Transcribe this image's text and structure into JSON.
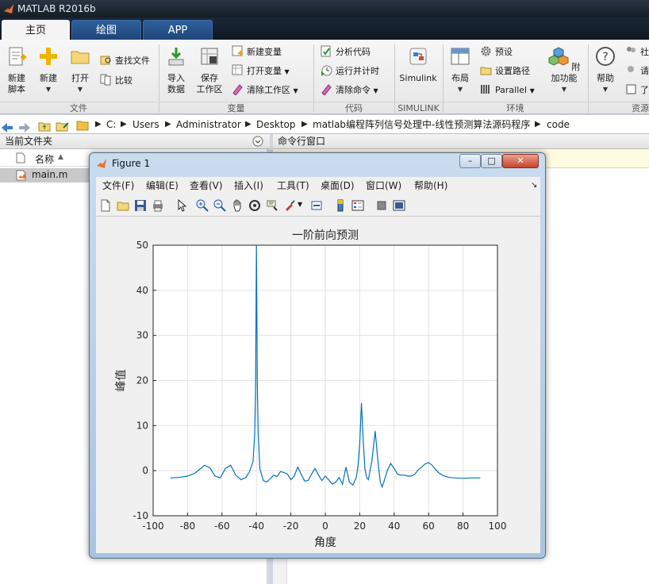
{
  "app": {
    "title": "MATLAB R2016b"
  },
  "tabs": [
    "主页",
    "绘图",
    "APP"
  ],
  "ribbon": {
    "new_script": "新建\n脚本",
    "new": "新建",
    "open": "打开",
    "find_files": "查找文件",
    "compare": "比较",
    "import_data": "导入\n数据",
    "save_workspace": "保存\n工作区",
    "new_variable": "新建变量",
    "open_variable": "打开变量",
    "clear_workspace": "清除工作区",
    "analyze_code": "分析代码",
    "run_and_time": "运行并计时",
    "clear_commands": "清除命令",
    "simulink": "Simulink",
    "layout": "布局",
    "preferences": "预设",
    "set_path": "设置路径",
    "parallel": "Parallel",
    "addons": "附加功能",
    "help": "帮助",
    "community_partial": "社",
    "request_partial": "请",
    "learn_partial": "了",
    "groups": [
      "文件",
      "变量",
      "代码",
      "SIMULINK",
      "环境",
      "资源"
    ]
  },
  "address": {
    "crumbs": [
      "C:",
      "Users",
      "Administrator",
      "Desktop",
      "matlab编程阵列信号处理中-线性预测算法源码程序",
      "code"
    ]
  },
  "file_panel": {
    "title": "当前文件夹",
    "column_name": "名称",
    "sort_arrow": "▲",
    "files": [
      "main.m"
    ]
  },
  "command_panel": {
    "title": "命令行窗口"
  },
  "figure": {
    "title": "Figure 1",
    "menu": [
      "文件(F)",
      "编辑(E)",
      "查看(V)",
      "插入(I)",
      "工具(T)",
      "桌面(D)",
      "窗口(W)",
      "帮助(H)"
    ],
    "menu_arrow": "↘",
    "win_buttons": {
      "min": "–",
      "max": "□",
      "close": "✕"
    }
  },
  "colors": {
    "accent": "#0072bd",
    "tab_blue": "#2f5f9c"
  },
  "chart_data": {
    "type": "line",
    "title": "一阶前向预测",
    "xlabel": "角度",
    "ylabel": "峰值",
    "xlim": [
      -100,
      100
    ],
    "ylim": [
      -10,
      50
    ],
    "xticks": [
      -100,
      -80,
      -60,
      -40,
      -20,
      0,
      20,
      40,
      60,
      80,
      100
    ],
    "yticks": [
      -10,
      0,
      10,
      20,
      30,
      40,
      50
    ],
    "grid": true,
    "color": "#0072bd",
    "series": [
      {
        "x": [
          -90,
          -85,
          -80,
          -76,
          -73,
          -70,
          -67,
          -64,
          -61,
          -58,
          -55,
          -52,
          -49,
          -46,
          -44,
          -42,
          -41,
          -40.5,
          -40,
          -39.5,
          -39,
          -38,
          -36,
          -34,
          -32,
          -30,
          -28,
          -26,
          -24,
          -22,
          -20,
          -18,
          -16,
          -14,
          -12,
          -10,
          -8,
          -6,
          -4,
          -2,
          0,
          2,
          4,
          6,
          8,
          10,
          12,
          14,
          16,
          18,
          19,
          20,
          21,
          22,
          23,
          24,
          25,
          26,
          27,
          28,
          29,
          30,
          31,
          32,
          33,
          34,
          36,
          38,
          40,
          42,
          44,
          46,
          48,
          50,
          52,
          54,
          56,
          58,
          60,
          62,
          64,
          66,
          68,
          70,
          72,
          75,
          80,
          85,
          90
        ],
        "y": [
          -1.6,
          -1.5,
          -1.2,
          -0.6,
          0.3,
          1.2,
          0.6,
          -1.2,
          -1.6,
          0.5,
          1.2,
          -1.0,
          -2.0,
          -1.5,
          -0.2,
          2.0,
          8.0,
          18.0,
          50.0,
          20.0,
          8.0,
          0.5,
          -2.2,
          -2.5,
          -1.8,
          -1.0,
          -1.3,
          -0.2,
          -0.4,
          -0.8,
          -2.0,
          -1.2,
          0.8,
          -0.8,
          -2.3,
          -2.2,
          -0.8,
          0.5,
          -0.9,
          -2.2,
          -1.2,
          -2.0,
          -3.0,
          -2.6,
          -1.5,
          -3.0,
          0.8,
          -2.5,
          -3.2,
          -1.5,
          1.0,
          6.0,
          15.0,
          7.0,
          0.5,
          -1.5,
          -2.0,
          0.0,
          2.0,
          5.5,
          8.8,
          4.5,
          0.5,
          -2.6,
          -3.6,
          -2.5,
          0.0,
          1.6,
          0.5,
          -0.8,
          -1.0,
          -1.0,
          -1.2,
          -1.2,
          -0.8,
          0.2,
          0.8,
          1.5,
          1.8,
          1.2,
          0.3,
          -0.5,
          -1.0,
          -1.3,
          -1.5,
          -1.6,
          -1.7,
          -1.6,
          -1.6
        ]
      }
    ]
  }
}
